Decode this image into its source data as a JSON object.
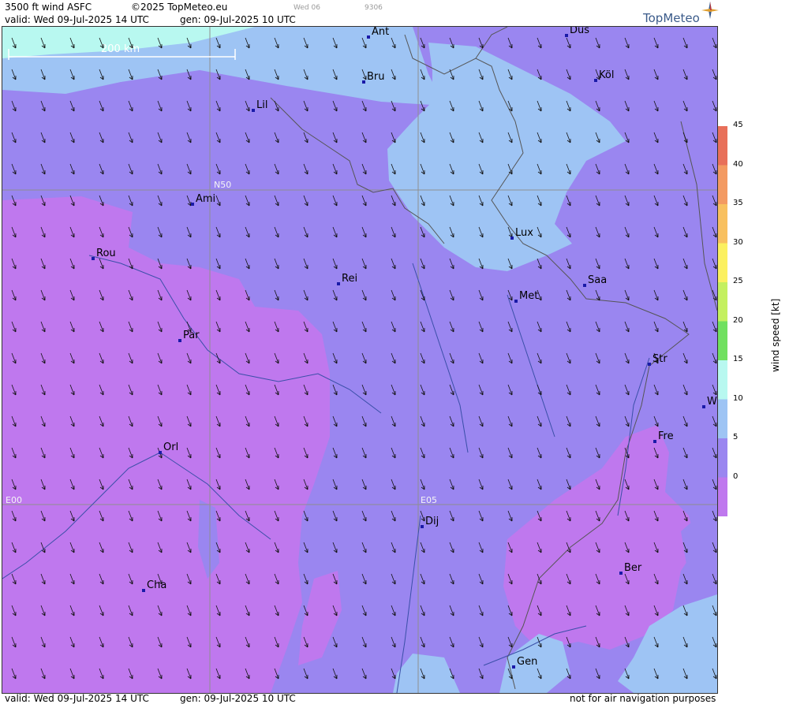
{
  "header": {
    "title": "3500 ft wind ASFC",
    "copyright": "©2025 TopMeteo.eu",
    "day_tab": "Wed 06",
    "code": "9306",
    "valid": "valid:  Wed  09-Jul-2025  14 UTC",
    "gen": "gen: 09-Jul-2025 10 UTC",
    "logo": "TopMeteo"
  },
  "scale_bar": {
    "label": "200 km"
  },
  "grid_labels": {
    "lat": "N50",
    "lon_west": "E00",
    "lon_east": "E05"
  },
  "cities": [
    {
      "name": "Ant"
    },
    {
      "name": "Düs"
    },
    {
      "name": "Bru"
    },
    {
      "name": "Köl"
    },
    {
      "name": "Lil"
    },
    {
      "name": "Ami"
    },
    {
      "name": "Lux"
    },
    {
      "name": "Rou"
    },
    {
      "name": "Rei"
    },
    {
      "name": "Saa"
    },
    {
      "name": "Met"
    },
    {
      "name": "Par"
    },
    {
      "name": "Str"
    },
    {
      "name": "W"
    },
    {
      "name": "Fre"
    },
    {
      "name": "Orl"
    },
    {
      "name": "Dij"
    },
    {
      "name": "Ber"
    },
    {
      "name": "Cha"
    },
    {
      "name": "Gen"
    }
  ],
  "legend": {
    "title": "wind speed [kt]",
    "ticks": [
      "45",
      "40",
      "35",
      "30",
      "25",
      "20",
      "15",
      "10",
      "5",
      "0"
    ],
    "colors": [
      "#e8705a",
      "#f39a62",
      "#f8c060",
      "#fbf060",
      "#c4f060",
      "#70e060",
      "#b8f8f0",
      "#9ec4f4",
      "#9a86f0",
      "#bf78ee"
    ]
  },
  "footer": {
    "valid": "valid:  Wed  09-Jul-2025  14 UTC",
    "gen": "gen: 09-Jul-2025 10 UTC",
    "disclaimer": "not for air navigation purposes"
  },
  "colors": {
    "calm": "#bf78ee",
    "light": "#9a86f0",
    "moderate": "#9ec4f4",
    "fresh": "#b8f8f0"
  }
}
